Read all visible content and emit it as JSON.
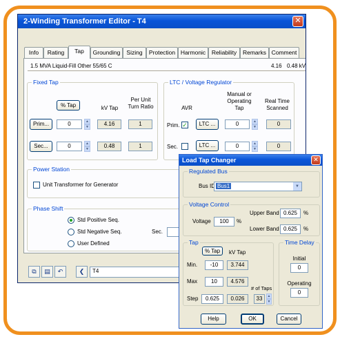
{
  "editor": {
    "title": "2-Winding Transformer Editor - T4",
    "close_glyph": "✕",
    "tabs": [
      {
        "label": "Info"
      },
      {
        "label": "Rating"
      },
      {
        "label": "Tap"
      },
      {
        "label": "Grounding"
      },
      {
        "label": "Sizing"
      },
      {
        "label": "Protection"
      },
      {
        "label": "Harmonic"
      },
      {
        "label": "Reliability"
      },
      {
        "label": "Remarks"
      },
      {
        "label": "Comment"
      }
    ],
    "active_tab": "Tap",
    "summary": {
      "left": "1.5 MVA  Liquid-Fill  Other  55/65 C",
      "kv_primary": "4.16",
      "kv_secondary": "0.48 kV"
    },
    "fixed_tap": {
      "title": "Fixed Tap",
      "pct_tap_button": "% Tap",
      "kv_tap_header": "kV Tap",
      "ratio_header": "Per Unit Turn Ratio",
      "prim_button": "Prim...",
      "sec_button": "Sec...",
      "prim_pct": "0",
      "sec_pct": "0",
      "prim_kv": "4.16",
      "sec_kv": "0.48",
      "prim_ratio": "1",
      "sec_ratio": "1"
    },
    "ltc": {
      "title": "LTC / Voltage Regulator",
      "avr_header": "AVR",
      "manual_header": "Manual or Operating Tap",
      "realtime_header": "Real Time Scanned",
      "prim_label": "Prim.",
      "sec_label": "Sec.",
      "prim_checked": true,
      "sec_checked": false,
      "ltc_button": "LTC ...",
      "prim_tap": "0",
      "sec_tap": "0",
      "prim_scanned": "0",
      "sec_scanned": "0"
    },
    "power_station": {
      "title": "Power Station",
      "unit_transformer_label": "Unit Transformer for Generator"
    },
    "phase_shift": {
      "title": "Phase Shift",
      "options": [
        "Std Positive Seq.",
        "Std Negative Seq.",
        "User Defined"
      ],
      "selected": "Std Positive Seq.",
      "sec_label": "Sec."
    },
    "footer": {
      "element_id": "T4"
    }
  },
  "ltc_dialog": {
    "title": "Load Tap Changer",
    "close_glyph": "✕",
    "regulated_bus": {
      "title": "Regulated Bus",
      "bus_id_label": "Bus ID",
      "bus_id_value": "Bus1"
    },
    "voltage_control": {
      "title": "Voltage Control",
      "voltage_label": "Voltage",
      "voltage_value": "100",
      "voltage_unit": "%",
      "upper_band_label": "Upper Band",
      "upper_band_value": "0.625",
      "lower_band_label": "Lower Band",
      "lower_band_value": "0.625",
      "band_unit": "%"
    },
    "tap": {
      "title": "Tap",
      "pct_tap_button": "% Tap",
      "kv_tap_header": "kV Tap",
      "min_label": "Min.",
      "min_pct": "-10",
      "min_kv": "3.744",
      "max_label": "Max",
      "max_pct": "10",
      "max_kv": "4.576",
      "step_label": "Step",
      "step_pct": "0.625",
      "step_kv": "0.026",
      "num_taps_label": "# of Taps",
      "num_taps_value": "33"
    },
    "time_delay": {
      "title": "Time Delay",
      "initial_label": "Initial",
      "initial_value": "0",
      "operating_label": "Operating",
      "operating_value": "0"
    },
    "buttons": {
      "help": "Help",
      "ok": "OK",
      "cancel": "Cancel"
    }
  }
}
